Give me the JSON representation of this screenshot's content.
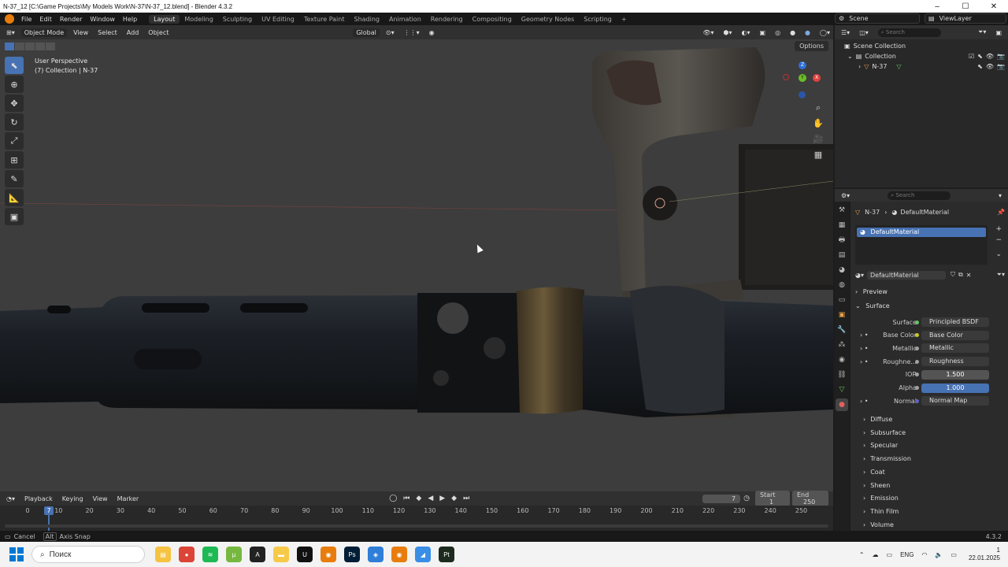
{
  "window": {
    "title": "N-37_12 [C:\\Game Projects\\My Models Work\\N-37\\N-37_12.blend] - Blender 4.3.2",
    "controls": [
      "–",
      "☐",
      "✕"
    ]
  },
  "menu": [
    "File",
    "Edit",
    "Render",
    "Window",
    "Help"
  ],
  "workspaces": [
    "Layout",
    "Modeling",
    "Sculpting",
    "UV Editing",
    "Texture Paint",
    "Shading",
    "Animation",
    "Rendering",
    "Compositing",
    "Geometry Nodes",
    "Scripting",
    "+"
  ],
  "active_workspace": "Layout",
  "scene": "Scene",
  "view_layer": "ViewLayer",
  "viewport_header": {
    "mode": "Object Mode",
    "items": [
      "View",
      "Select",
      "Add",
      "Object"
    ],
    "orientation": "Global"
  },
  "viewport": {
    "perspective": "User Perspective",
    "collection": "(7) Collection | N-37",
    "options": "Options",
    "gizmo_axes": [
      "Z",
      "Y",
      "X"
    ]
  },
  "timeline": {
    "menus": [
      "Playback",
      "Keying",
      "View",
      "Marker"
    ],
    "current_frame": "7",
    "start_label": "Start",
    "start": "1",
    "end_label": "End",
    "end": "250",
    "ticks": [
      "0",
      "10",
      "20",
      "30",
      "40",
      "50",
      "60",
      "70",
      "80",
      "90",
      "100",
      "110",
      "120",
      "130",
      "140",
      "150",
      "160",
      "170",
      "180",
      "190",
      "200",
      "210",
      "220",
      "230",
      "240",
      "250"
    ],
    "playhead_label": "7"
  },
  "status": {
    "cancel": "Cancel",
    "alt_key": "Alt",
    "axis_snap": "Axis Snap",
    "version": "4.3.2"
  },
  "outliner": {
    "search_placeholder": "Search",
    "root": "Scene Collection",
    "collection": "Collection",
    "object": "N-37"
  },
  "properties": {
    "search_placeholder": "Search",
    "breadcrumb_object": "N-37",
    "breadcrumb_material": "DefaultMaterial",
    "slot": "DefaultMaterial",
    "material_name": "DefaultMaterial",
    "sections": {
      "preview": "Preview",
      "surface": "Surface"
    },
    "rows": [
      {
        "label": "Surface",
        "value": "Principled BSDF",
        "dot": "#63c763"
      },
      {
        "label": "Base Color",
        "value": "Base Color",
        "dot": "#c7c729"
      },
      {
        "label": "Metallic",
        "value": "Metallic",
        "dot": "#a1a1a1"
      },
      {
        "label": "Roughne...",
        "value": "Roughness",
        "dot": "#a1a1a1"
      },
      {
        "label": "IOR",
        "value": "1.500",
        "dot": "#a1a1a1"
      },
      {
        "label": "Alpha",
        "value": "1.000",
        "dot": "#a1a1a1"
      },
      {
        "label": "Normal",
        "value": "Normal Map",
        "dot": "#6363c7"
      }
    ],
    "subsections": [
      "Diffuse",
      "Subsurface",
      "Specular",
      "Transmission",
      "Coat",
      "Sheen",
      "Emission",
      "Thin Film",
      "Volume"
    ]
  },
  "taskbar": {
    "search": "Поиск",
    "icons": [
      {
        "name": "file-explorer-icon",
        "color": "#f5c242",
        "glyph": "▤"
      },
      {
        "name": "chrome-icon",
        "color": "#db4437",
        "glyph": "●"
      },
      {
        "name": "spotify-icon",
        "color": "#1db954",
        "glyph": "≋"
      },
      {
        "name": "utorrent-icon",
        "color": "#76b83f",
        "glyph": "µ"
      },
      {
        "name": "affinity-icon",
        "color": "#222222",
        "glyph": "A"
      },
      {
        "name": "folder-icon",
        "color": "#f7c948",
        "glyph": "▬"
      },
      {
        "name": "unreal-icon",
        "color": "#111111",
        "glyph": "U"
      },
      {
        "name": "blender-icon",
        "color": "#e87d0d",
        "glyph": "◉"
      },
      {
        "name": "photoshop-icon",
        "color": "#001e36",
        "glyph": "Ps"
      },
      {
        "name": "blue-app-icon",
        "color": "#2f7ed8",
        "glyph": "◈"
      },
      {
        "name": "blender-active-icon",
        "color": "#e87d0d",
        "glyph": "◉"
      },
      {
        "name": "azure-icon",
        "color": "#3a8ee6",
        "glyph": "◢"
      },
      {
        "name": "painter-icon",
        "color": "#1d2b1f",
        "glyph": "Pt"
      }
    ],
    "lang": "ENG",
    "time": "1",
    "date": "22.01.2025"
  }
}
